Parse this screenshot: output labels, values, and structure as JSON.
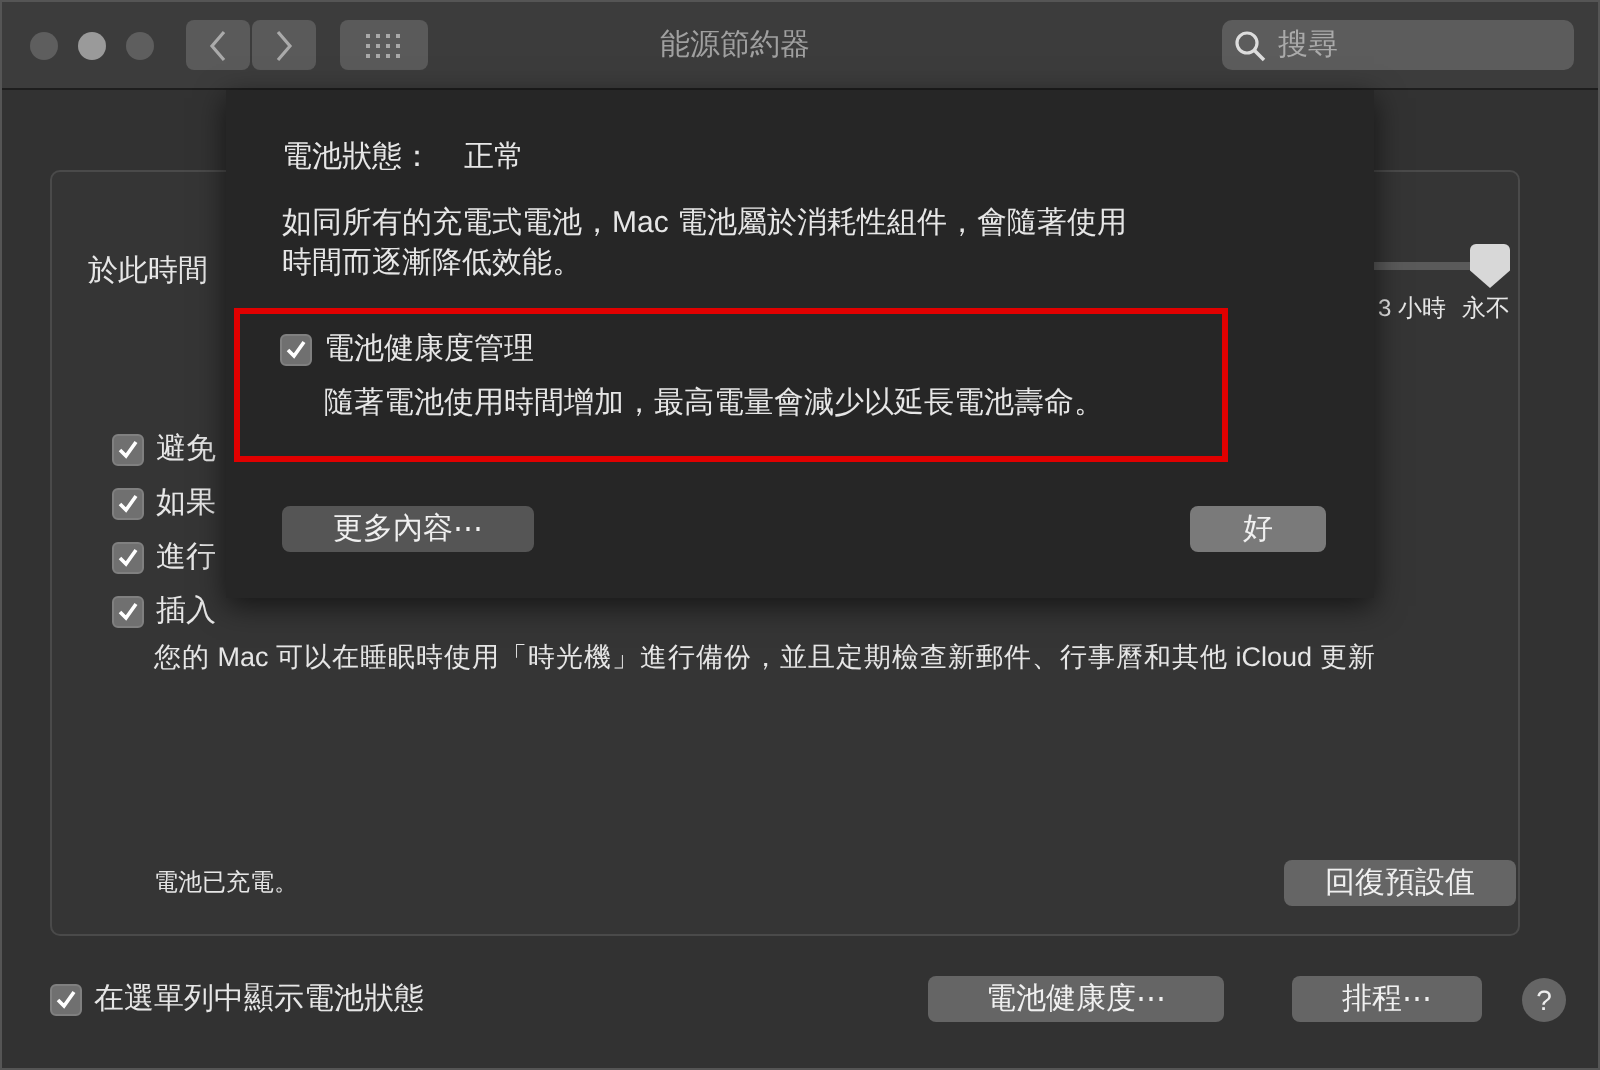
{
  "window": {
    "title": "能源節約器",
    "search": {
      "placeholder": "搜尋"
    }
  },
  "panel": {
    "slider_label": "於此時間",
    "slider": {
      "level": 1,
      "ticks": [
        "3 小時",
        "永不"
      ]
    },
    "options": [
      {
        "label": "避免",
        "checked": true
      },
      {
        "label": "如果",
        "checked": true
      },
      {
        "label": "進行",
        "checked": true
      },
      {
        "label": "插入",
        "checked": true
      }
    ],
    "note": "您的 Mac 可以在睡眠時使用「時光機」進行備份，並且定期檢查新郵件、行事曆和其他 iCloud 更新",
    "battery_status": "電池已充電。",
    "restore_button": "回復預設值"
  },
  "sheet": {
    "status_label": "電池狀態：",
    "status_value": "正常",
    "description": "如同所有的充電式電池，Mac 電池屬於消耗性組件，會隨著使用時間而逐漸降低效能。",
    "option": {
      "label": "電池健康度管理",
      "checked": true,
      "description": "隨著電池使用時間增加，最高電量會減少以延長電池壽命。"
    },
    "more_button": "更多內容⋯",
    "ok_button": "好"
  },
  "footer": {
    "show_status": {
      "label": "在選單列中顯示電池狀態",
      "checked": true
    },
    "buttons": [
      "電池健康度⋯",
      "排程⋯"
    ],
    "help": "?"
  }
}
